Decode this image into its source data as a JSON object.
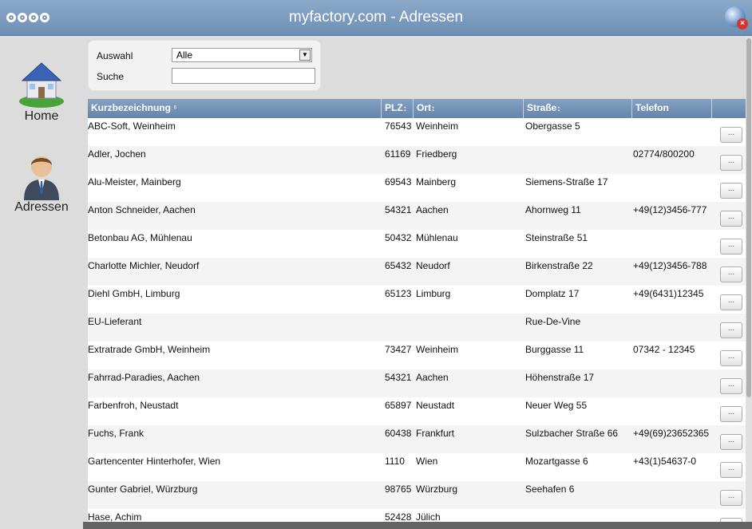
{
  "window": {
    "title": "myfactory.com - Adressen",
    "icons": [
      "window-dots-icon",
      "globe-close-icon"
    ]
  },
  "sidebar": {
    "items": [
      {
        "label": "Home",
        "icon": "house-icon"
      },
      {
        "label": "Adressen",
        "icon": "person-icon"
      }
    ]
  },
  "filter": {
    "auswahl_label": "Auswahl",
    "auswahl_value": "Alle",
    "suche_label": "Suche",
    "suche_value": "",
    "suche_placeholder": ""
  },
  "table": {
    "headers": [
      "Kurzbezeichnung",
      "PLZ",
      "Ort",
      "Straße",
      "Telefon"
    ],
    "sort_icon_kurz": "⁶",
    "sort_icon": "↕",
    "row_button_label": "...",
    "rows": [
      {
        "name": "ABC-Soft, Weinheim",
        "plz": "76543",
        "ort": "Weinheim",
        "strasse": "Obergasse 5",
        "telefon": ""
      },
      {
        "name": "Adler, Jochen",
        "plz": "61169",
        "ort": "Friedberg",
        "strasse": "",
        "telefon": "02774/800200"
      },
      {
        "name": "Alu-Meister, Mainberg",
        "plz": "69543",
        "ort": "Mainberg",
        "strasse": "Siemens-Straße 17",
        "telefon": ""
      },
      {
        "name": "Anton Schneider, Aachen",
        "plz": "54321",
        "ort": "Aachen",
        "strasse": "Ahornweg 11",
        "telefon": "+49(12)3456-777"
      },
      {
        "name": "Betonbau AG, Mühlenau",
        "plz": "50432",
        "ort": "Mühlenau",
        "strasse": "Steinstraße 51",
        "telefon": ""
      },
      {
        "name": "Charlotte Michler, Neudorf",
        "plz": "65432",
        "ort": "Neudorf",
        "strasse": "Birkenstraße 22",
        "telefon": "+49(12)3456-788"
      },
      {
        "name": "Diehl GmbH, Limburg",
        "plz": "65123",
        "ort": "Limburg",
        "strasse": "Domplatz 17",
        "telefon": "+49(6431)12345"
      },
      {
        "name": "EU-Lieferant",
        "plz": "",
        "ort": "",
        "strasse": "Rue-De-Vine",
        "telefon": ""
      },
      {
        "name": "Extratrade GmbH, Weinheim",
        "plz": "73427",
        "ort": "Weinheim",
        "strasse": "Burggasse 11",
        "telefon": "07342 - 12345"
      },
      {
        "name": "Fahrrad-Paradies, Aachen",
        "plz": "54321",
        "ort": "Aachen",
        "strasse": "Höhenstraße 17",
        "telefon": ""
      },
      {
        "name": "Farbenfroh, Neustadt",
        "plz": "65897",
        "ort": "Neustadt",
        "strasse": "Neuer Weg 55",
        "telefon": ""
      },
      {
        "name": "Fuchs, Frank",
        "plz": "60438",
        "ort": "Frankfurt",
        "strasse": "Sulzbacher Straße 66",
        "telefon": "+49(69)23652365"
      },
      {
        "name": "Gartencenter Hinterhofer, Wien",
        "plz": "1110",
        "ort": "Wien",
        "strasse": "Mozartgasse 6",
        "telefon": "+43(1)54637-0"
      },
      {
        "name": "Gunter Gabriel, Würzburg",
        "plz": "98765",
        "ort": "Würzburg",
        "strasse": "Seehafen 6",
        "telefon": ""
      },
      {
        "name": "Hase, Achim",
        "plz": "52428",
        "ort": "Jülich",
        "strasse": "",
        "telefon": ""
      }
    ]
  }
}
